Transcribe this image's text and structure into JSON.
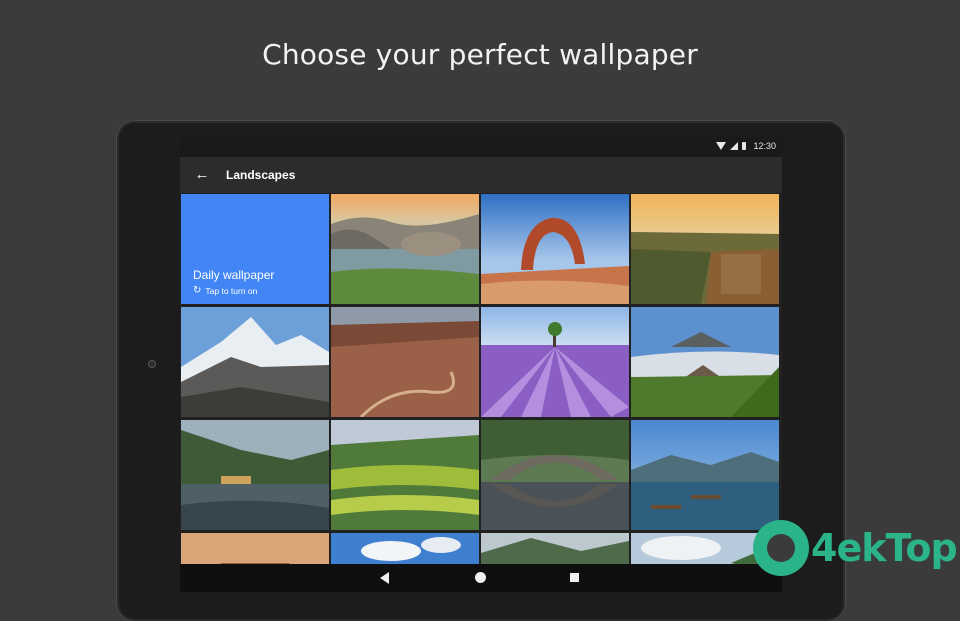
{
  "headline": "Choose your perfect wallpaper",
  "status_bar": {
    "time": "12:30",
    "icons": [
      "wifi-icon",
      "signal-icon",
      "battery-icon"
    ]
  },
  "app_bar": {
    "back_icon": "arrow-back-icon",
    "title": "Landscapes"
  },
  "daily_wallpaper": {
    "title": "Daily wallpaper",
    "subtitle": "Tap to turn on",
    "icon": "refresh-icon",
    "color": "#4285f4"
  },
  "wallpapers": [
    {
      "subject": "rocky-lake-sunset"
    },
    {
      "subject": "red-rock-arch"
    },
    {
      "subject": "canyon-cliffs-sunset"
    },
    {
      "subject": "snowy-mountain-peaks"
    },
    {
      "subject": "desert-canyon-road"
    },
    {
      "subject": "lavender-field-tree"
    },
    {
      "subject": "volcano-valley"
    },
    {
      "subject": "mountain-lake-village"
    },
    {
      "subject": "rice-terraces"
    },
    {
      "subject": "stone-bridge-river"
    },
    {
      "subject": "boats-mountain-bay"
    },
    {
      "subject": "desert-mesa"
    },
    {
      "subject": "blue-sky-clouds"
    },
    {
      "subject": "misty-green-hills"
    },
    {
      "subject": "cloudy-coast"
    }
  ],
  "nav_bar": {
    "icons": [
      "back-nav-icon",
      "home-nav-icon",
      "recents-nav-icon"
    ]
  },
  "watermark": {
    "text": "4ekTop"
  }
}
